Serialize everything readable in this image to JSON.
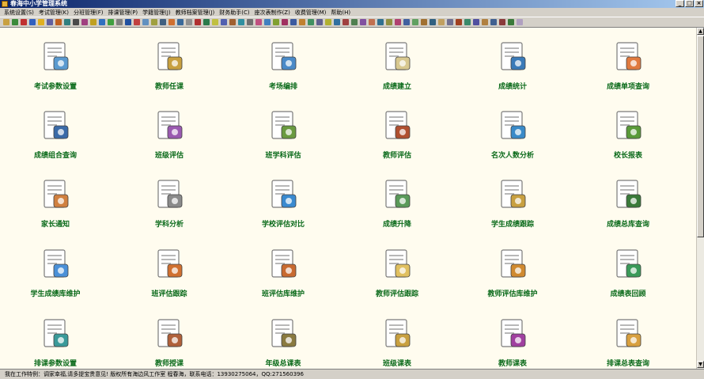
{
  "window": {
    "title": "春海中小学管理系统",
    "controls": [
      "_",
      "□",
      "×"
    ]
  },
  "menu": [
    "系统设置(S)",
    "考试管理(K)",
    "分班管理(F)",
    "排课管理(P)",
    "学籍管理(J)",
    "教师档案管理(J)",
    "财务助手(C)",
    "座次表制作(Z)",
    "收费管理(M)",
    "帮助(H)"
  ],
  "toolbar_colors": [
    "#c8a040",
    "#3a8a3a",
    "#c03030",
    "#3060c0",
    "#e0b020",
    "#6060a0",
    "#c06020",
    "#308080",
    "#4a4a4a",
    "#a04080",
    "#c0a020",
    "#3070c0",
    "#40a040",
    "#808080",
    "#2050a0",
    "#c04040",
    "#6090c0",
    "#a0a040",
    "#406080",
    "#d07030",
    "#3a6a9a",
    "#909090",
    "#b03030",
    "#2a7a4a",
    "#c0c040",
    "#5060b0",
    "#a06030",
    "#3090a0",
    "#707070",
    "#c05080",
    "#4080c0",
    "#80a030",
    "#a03060",
    "#3a5aa0",
    "#c08030",
    "#409060",
    "#606090",
    "#b0b030",
    "#3070a0",
    "#a04040",
    "#508050",
    "#8050a0",
    "#c07050",
    "#307090",
    "#909040",
    "#b04070",
    "#4060a0",
    "#60a060",
    "#a07030",
    "#306080",
    "#c0a060",
    "#707090",
    "#a04020",
    "#3a8a6a",
    "#5050a0",
    "#b08040",
    "#406090",
    "#8a3a3a",
    "#3a7a3a",
    "#b0a0c0"
  ],
  "tiles": [
    {
      "label": "考试参数设置",
      "icon": "doc-settings-icon",
      "color": "#5a9ad0"
    },
    {
      "label": "教师任课",
      "icon": "teacher-schedule-icon",
      "color": "#c8a040"
    },
    {
      "label": "考场编排",
      "icon": "exam-room-icon",
      "color": "#4a8ac8"
    },
    {
      "label": "成绩建立",
      "icon": "score-create-icon",
      "color": "#d8c890"
    },
    {
      "label": "成绩统计",
      "icon": "score-statistics-icon",
      "color": "#3a7ab8"
    },
    {
      "label": "成绩单项查询",
      "icon": "single-query-icon",
      "color": "#e07a40"
    },
    {
      "label": "成绩组合查询",
      "icon": "combined-query-icon",
      "color": "#3a6aa8"
    },
    {
      "label": "班级评估",
      "icon": "class-evaluation-icon",
      "color": "#9a5ab0"
    },
    {
      "label": "班学科评估",
      "icon": "subject-evaluation-icon",
      "color": "#6a9a40"
    },
    {
      "label": "教师评估",
      "icon": "teacher-evaluation-icon",
      "color": "#b05030"
    },
    {
      "label": "名次人数分析",
      "icon": "rank-analysis-icon",
      "color": "#3a8ac8"
    },
    {
      "label": "校长报表",
      "icon": "principal-report-icon",
      "color": "#5a9a3a"
    },
    {
      "label": "家长通知",
      "icon": "parent-notice-icon",
      "color": "#d08040"
    },
    {
      "label": "学科分析",
      "icon": "subject-analysis-icon",
      "color": "#8a8a8a"
    },
    {
      "label": "学校评估对比",
      "icon": "school-compare-icon",
      "color": "#3a8ad0"
    },
    {
      "label": "成绩升降",
      "icon": "score-trend-icon",
      "color": "#5a9a5a"
    },
    {
      "label": "学生成绩跟踪",
      "icon": "student-tracking-icon",
      "color": "#c8a040"
    },
    {
      "label": "成绩总库查询",
      "icon": "score-archive-icon",
      "color": "#3a7a3a"
    },
    {
      "label": "学生成绩库维护",
      "icon": "student-db-icon",
      "color": "#4a90d8"
    },
    {
      "label": "班评估跟踪",
      "icon": "class-tracking-icon",
      "color": "#d07030"
    },
    {
      "label": "班评估库维护",
      "icon": "class-db-icon",
      "color": "#c86a30"
    },
    {
      "label": "教师评估跟踪",
      "icon": "teacher-tracking-icon",
      "color": "#e0c060"
    },
    {
      "label": "教师评估库维护",
      "icon": "teacher-db-icon",
      "color": "#d08a30"
    },
    {
      "label": "成绩表回顾",
      "icon": "score-review-icon",
      "color": "#3a9a5a"
    },
    {
      "label": "排课参数设置",
      "icon": "timetable-settings-icon",
      "color": "#3a9a9a"
    },
    {
      "label": "教师授课",
      "icon": "teacher-teaching-icon",
      "color": "#b0603a"
    },
    {
      "label": "年级总课表",
      "icon": "grade-timetable-icon",
      "color": "#8a7a40"
    },
    {
      "label": "班级课表",
      "icon": "class-timetable-icon",
      "color": "#c8a040"
    },
    {
      "label": "教师课表",
      "icon": "teacher-timetable-icon",
      "color": "#a040a0"
    },
    {
      "label": "排课总表查询",
      "icon": "timetable-query-icon",
      "color": "#d8a040"
    }
  ],
  "status": "我在工作特例：调家幸福,请多提宝贵意见!  版权所有海边风工作室 程春海，联系电话：13930275064，QQ:271560396"
}
